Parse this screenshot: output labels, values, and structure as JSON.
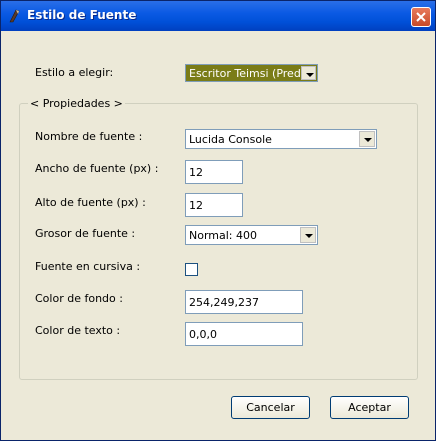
{
  "window": {
    "title": "Estilo de Fuente"
  },
  "style_select": {
    "label": "Estilo a elegir:",
    "value": "Escritor Teimsi (Predet.)"
  },
  "group": {
    "label": "< Propiedades >"
  },
  "font_name": {
    "label": "Nombre de fuente :",
    "value": "Lucida Console"
  },
  "font_width": {
    "label": "Ancho de fuente (px) :",
    "value": "12"
  },
  "font_height": {
    "label": "Alto de fuente (px) :",
    "value": "12"
  },
  "font_weight": {
    "label": "Grosor de fuente  :",
    "value": "Normal: 400"
  },
  "italic": {
    "label": "Fuente en cursiva :",
    "checked": false
  },
  "bg_color": {
    "label": "Color de fondo :",
    "value": "254,249,237"
  },
  "text_color": {
    "label": "Color de texto :",
    "value": "0,0,0"
  },
  "buttons": {
    "cancel": "Cancelar",
    "accept": "Aceptar"
  },
  "icons": {
    "app": "quill-pen-icon",
    "close": "close-icon"
  },
  "colors": {
    "titlebar": "#0050d8",
    "dialog_bg": "#ece9d8",
    "selection": "#7a7c17"
  }
}
